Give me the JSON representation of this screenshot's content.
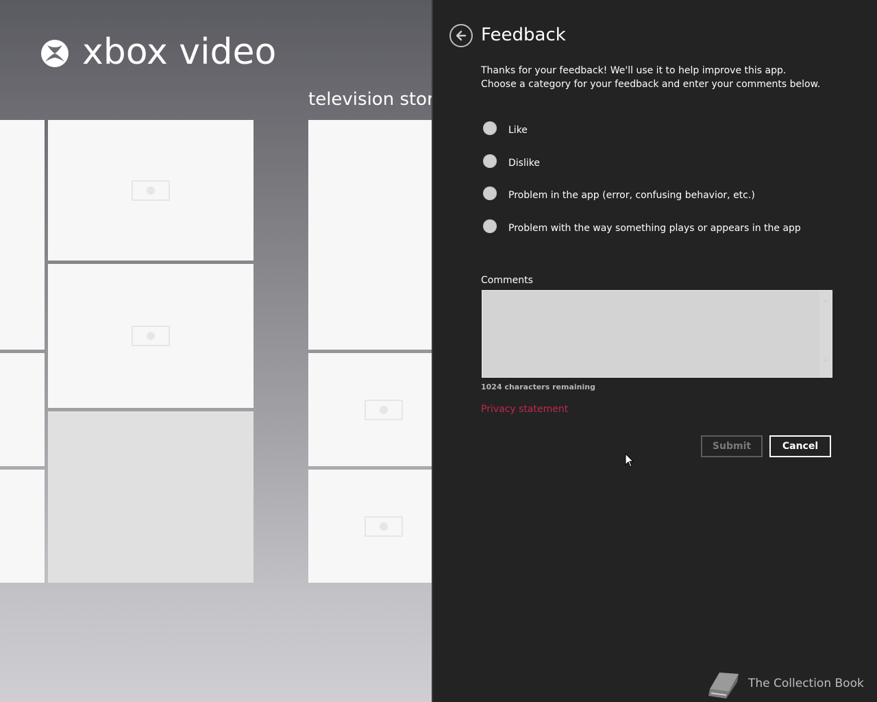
{
  "app": {
    "title": "xbox video",
    "section_title": "television store"
  },
  "feedback": {
    "title": "Feedback",
    "intro_line1": "Thanks for your feedback! We'll use it to help improve this app.",
    "intro_line2": "Choose a category for your feedback and enter your comments below.",
    "options": [
      {
        "label": "Like"
      },
      {
        "label": "Dislike"
      },
      {
        "label": "Problem in the app (error, confusing behavior, etc.)"
      },
      {
        "label": "Problem with the way something plays or appears in the app"
      }
    ],
    "comments_label": "Comments",
    "comments_value": "",
    "chars_remaining": "1024 characters remaining",
    "privacy_link": "Privacy statement",
    "submit_label": "Submit",
    "cancel_label": "Cancel"
  },
  "watermark": {
    "text": "The Collection Book"
  },
  "colors": {
    "flyout_bg": "#232323",
    "link": "#c0284f",
    "radio": "#cfcfcf",
    "textbox": "#d3d3d3"
  }
}
